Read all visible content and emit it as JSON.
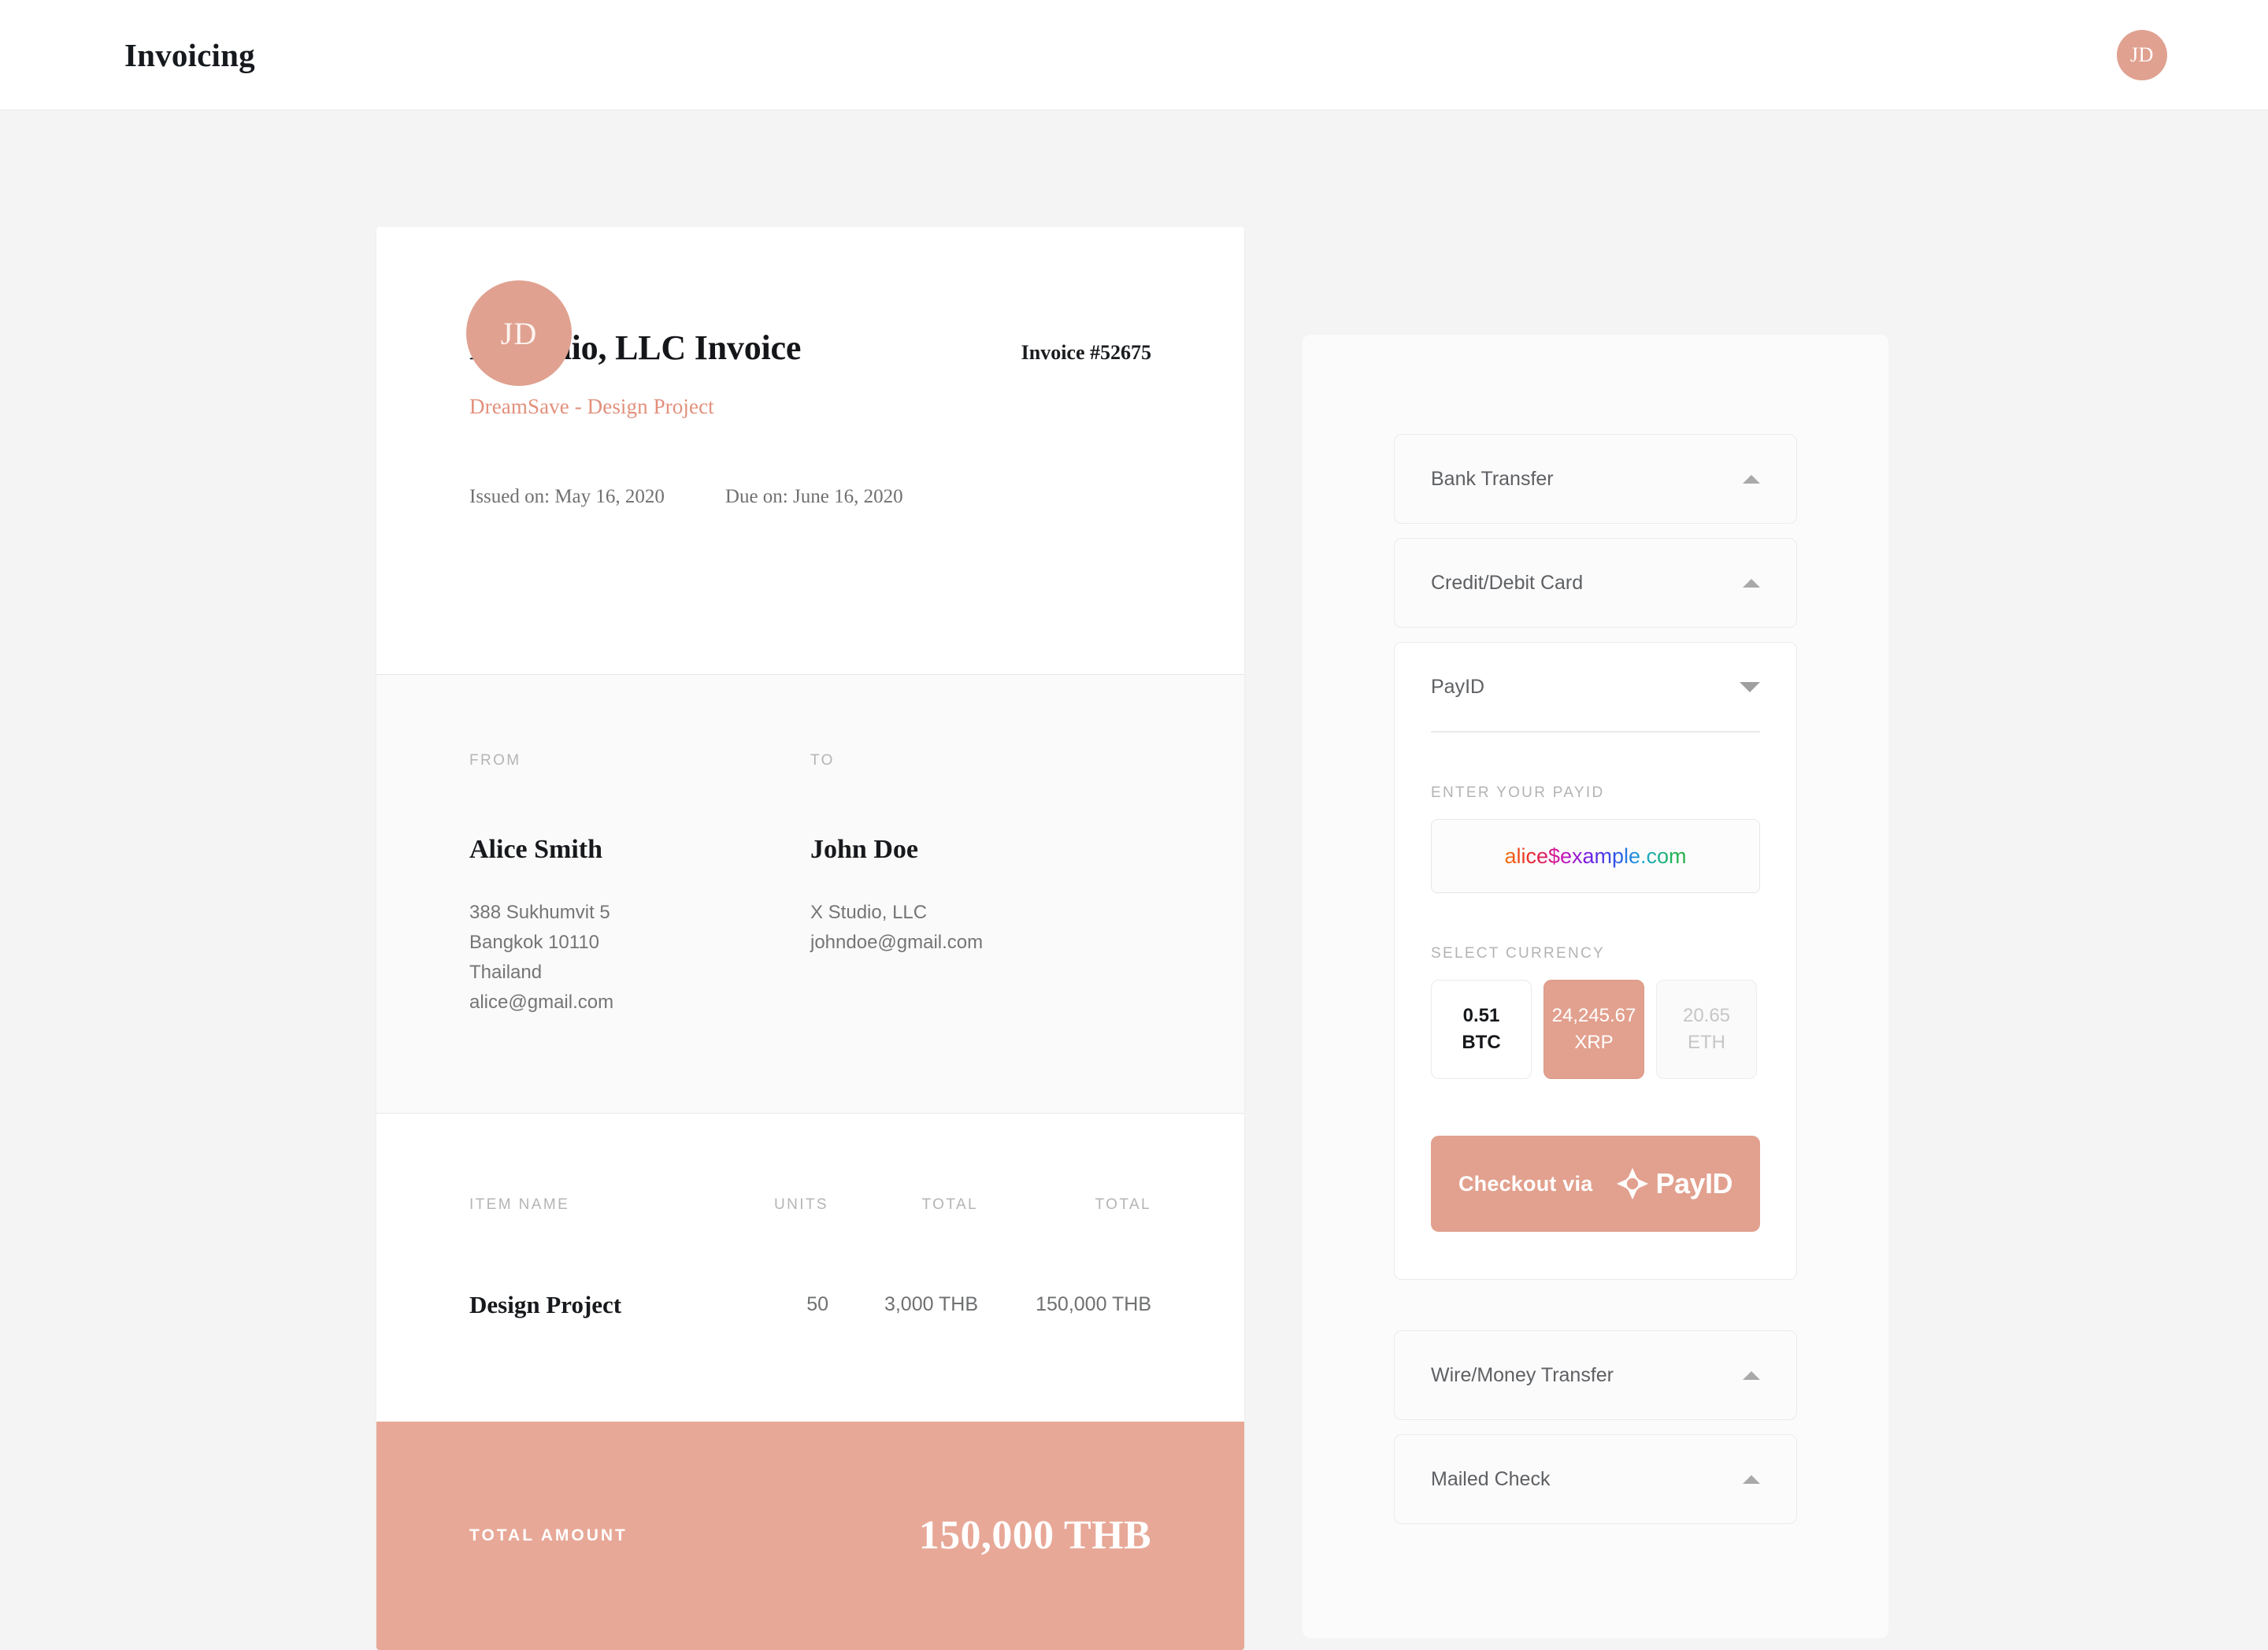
{
  "header": {
    "title": "Invoicing",
    "avatar_initials": "JD"
  },
  "invoice": {
    "avatar_initials": "JD",
    "title": "X Studio, LLC Invoice",
    "number": "Invoice #52675",
    "project": "DreamSave - Design Project",
    "issued_on": "Issued on: May 16, 2020",
    "due_on": "Due on: June 16, 2020",
    "from": {
      "label": "FROM",
      "name": "Alice Smith",
      "lines": "388 Sukhumvit 5\nBangkok 10110\nThailand\nalice@gmail.com"
    },
    "to": {
      "label": "TO",
      "name": "John Doe",
      "lines": "X Studio, LLC\njohndoe@gmail.com"
    },
    "items": {
      "columns": [
        "ITEM NAME",
        "UNITS",
        "TOTAL",
        "TOTAL"
      ],
      "rows": [
        {
          "name": "Design Project",
          "units": "50",
          "unit_total": "3,000 THB",
          "line_total": "150,000 THB"
        }
      ]
    },
    "total": {
      "label": "TOTAL AMOUNT",
      "value": "150,000 THB"
    }
  },
  "payment": {
    "methods_top": [
      {
        "label": "Bank Transfer",
        "caret": "chevron-up-icon"
      },
      {
        "label": "Credit/Debit Card",
        "caret": "chevron-up-icon"
      }
    ],
    "expanded": {
      "label": "PayID",
      "caret": "chevron-down-icon",
      "payid_field_label": "ENTER YOUR PAYID",
      "payid_value": "alice$example.com",
      "currency_label": "SELECT CURRENCY",
      "currencies": [
        {
          "amount": "0.51",
          "symbol": "BTC",
          "state": "default"
        },
        {
          "amount": "24,245.67",
          "symbol": "XRP",
          "state": "selected"
        },
        {
          "amount": "20.65",
          "symbol": "ETH",
          "state": "muted"
        }
      ],
      "checkout_text": "Checkout via",
      "checkout_brand": "PayID"
    },
    "methods_bottom": [
      {
        "label": "Wire/Money Transfer",
        "caret": "chevron-up-icon"
      },
      {
        "label": "Mailed Check",
        "caret": "chevron-up-icon"
      }
    ]
  },
  "colors": {
    "accent": "#e2a08e",
    "total_bar": "#e8a897",
    "project_text": "#e2907c",
    "page_bg": "#f4f4f4"
  }
}
